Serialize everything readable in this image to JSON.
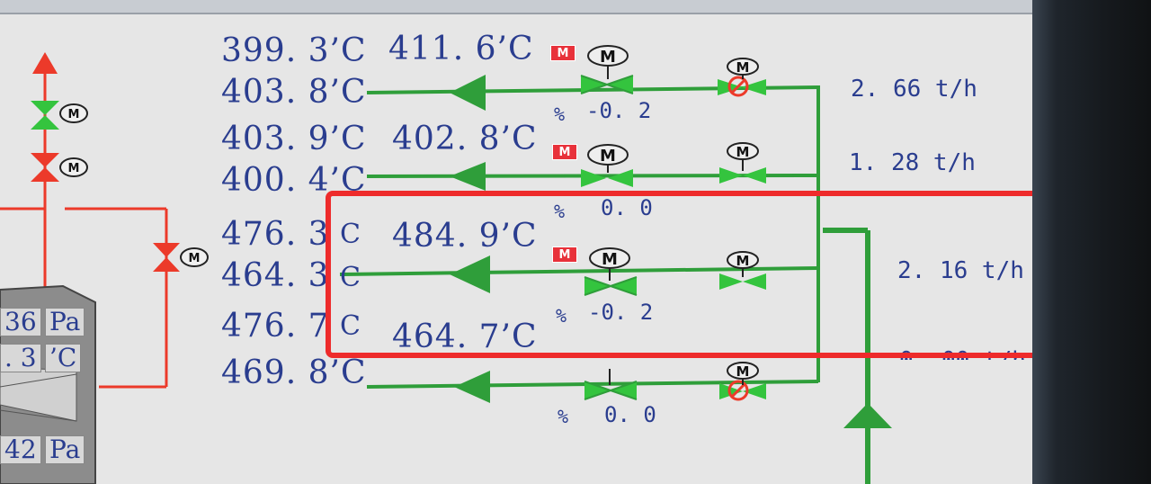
{
  "screen": {
    "temps_left": [
      "399. 3’C",
      "403. 8’C",
      "403. 9’C",
      "400. 4’C",
      "476. 3",
      "464. 3",
      "476. 7",
      "469. 8’C"
    ],
    "temps_mid": [
      "411. 6’C",
      "402. 8’C",
      "484. 9’C",
      "464. 7’C"
    ],
    "unit_c": "C",
    "flows": [
      "2. 66 t/h",
      "1. 28 t/h",
      "2. 16 t/h"
    ],
    "flow_partial": "0. 00 t/h",
    "valve_pct_label": "%",
    "valve_values": [
      "-0. 2",
      "0. 0",
      "-0. 2",
      "0. 0"
    ],
    "m_tag": "M",
    "motor_label": "M",
    "left_panel": {
      "pa_values": [
        "36",
        "42"
      ],
      "pa_unit": "Pa",
      "temp_partial": ". 3",
      "temp_unit": "’C"
    }
  },
  "colors": {
    "pipe_green": "#2f9e3a",
    "pipe_red": "#ec3a2a",
    "text_blue": "#2a3d8f",
    "highlight": "#ee2b2b"
  }
}
